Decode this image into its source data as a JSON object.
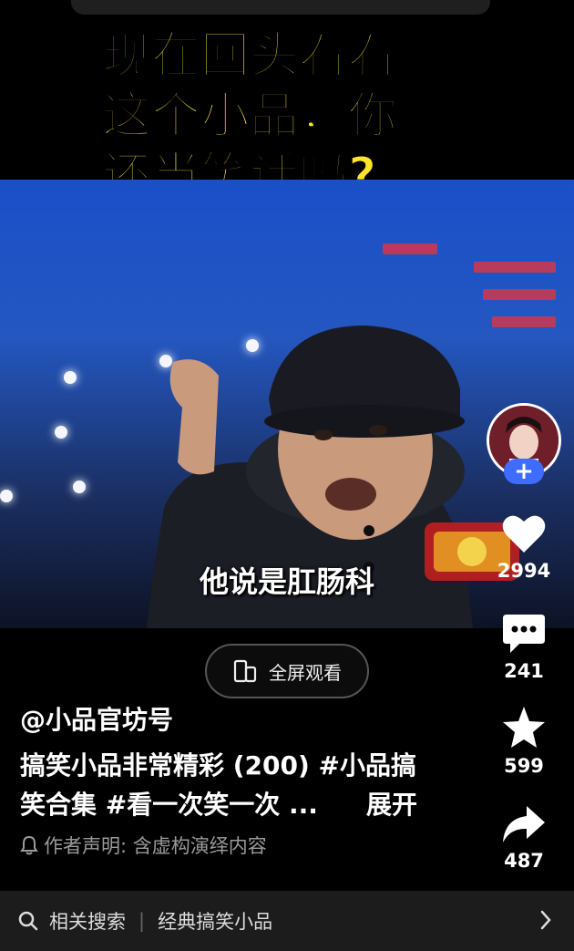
{
  "overlay_title": "现在回头看看\n这个小品，你\n还当笑话吗?",
  "video": {
    "subtitle": "他说是肛肠科"
  },
  "fullscreen_button": {
    "label": "全屏观看",
    "icon": "fullscreen-icon"
  },
  "post": {
    "author": "@小品官坊号",
    "description": "搞笑小品非常精彩 (200) #小品搞笑合集 #看一次笑一次 ...",
    "expand_label": "展开",
    "disclaimer": "作者声明: 含虚构演绎内容"
  },
  "actions": {
    "likes": "2994",
    "comments": "241",
    "favorites": "599",
    "shares": "487"
  },
  "related_search": {
    "label": "相关搜索",
    "query": "经典搞笑小品"
  },
  "colors": {
    "title_yellow": "#ffe52a",
    "follow_blue": "#3f6bff",
    "background": "#000000"
  }
}
